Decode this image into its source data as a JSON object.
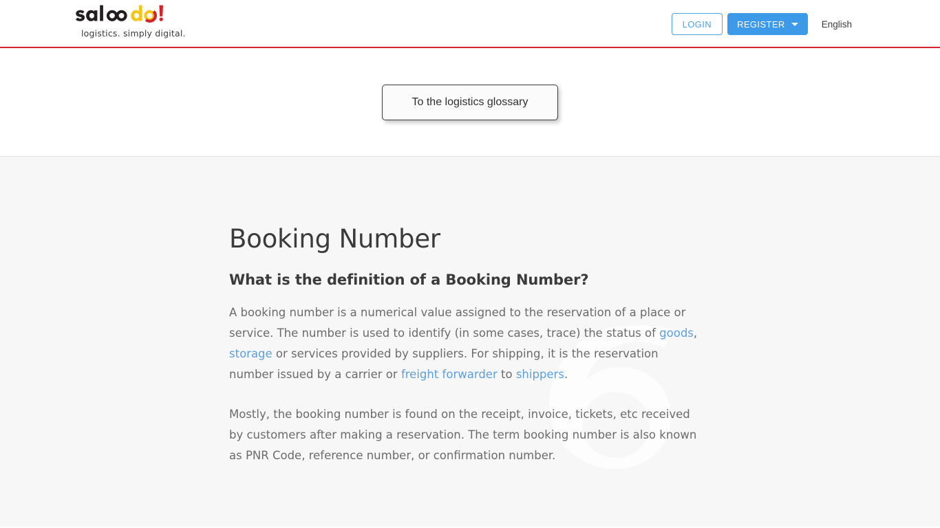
{
  "header": {
    "brand": {
      "name": "saloodo!",
      "tagline": "logistics. simply digital.",
      "logo_parts": {
        "dark_1": "sal",
        "infinity": "oo",
        "gold": "do",
        "red_mark": "!"
      },
      "colors": {
        "dark": "#231f20",
        "gold": "#f5c518",
        "red": "#d2232a"
      }
    },
    "login_label": "LOGIN",
    "register_label": "REGISTER",
    "register_caret": "chevron-down-icon",
    "language": "English",
    "accent_blue": "#3d9ae8",
    "rule_color": "#d2232a"
  },
  "glossary": {
    "button_label": "To the logistics glossary"
  },
  "article": {
    "title": "Booking Number",
    "section_heading": "What is the definition of a Booking Number?",
    "paragraph_1": {
      "part_1": "A booking number is a numerical value assigned to the reservation of a place or service. The number is used to identify (in some cases, trace) the status of ",
      "link_1": "goods",
      "part_2": ", ",
      "link_2": "storage",
      "part_3": " or services provided by suppliers. For shipping, it is the reservation number issued by a carrier or ",
      "link_3": "freight forwarder",
      "part_4": " to ",
      "link_4": "shippers",
      "part_5": "."
    },
    "paragraph_2": "Mostly, the booking number is found on the receipt, invoice, tickets, etc received by customers after making a reservation. The term booking number is also known as PNR Code, reference number, or confirmation number.",
    "link_color": "#5d9fdc",
    "text_color": "#6b6b6b",
    "background_color": "#f7f7f7"
  }
}
